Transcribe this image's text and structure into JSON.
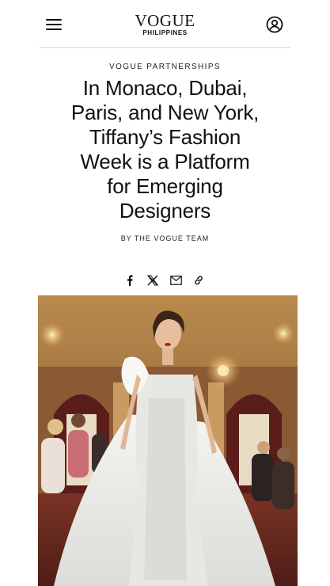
{
  "header": {
    "logo_main": "VOGUE",
    "logo_sub": "PHILIPPINES",
    "menu_icon": "hamburger-menu-icon",
    "account_icon": "user-account-icon"
  },
  "article": {
    "kicker": "VOGUE PARTNERSHIPS",
    "title_lines": [
      "In Monaco, Dubai,",
      "Paris, and New York,",
      "Tiffany’s Fashion",
      "Week is a Platform",
      "for Emerging",
      "Designers"
    ],
    "byline": "BY THE VOGUE TEAM"
  },
  "share": {
    "icons": [
      "facebook-icon",
      "x-twitter-icon",
      "email-icon",
      "link-icon"
    ]
  },
  "hero_image": {
    "description_icon": "runway-photo"
  },
  "colors": {
    "text": "#111111",
    "divider": "#e6e6e6",
    "background": "#ffffff"
  }
}
